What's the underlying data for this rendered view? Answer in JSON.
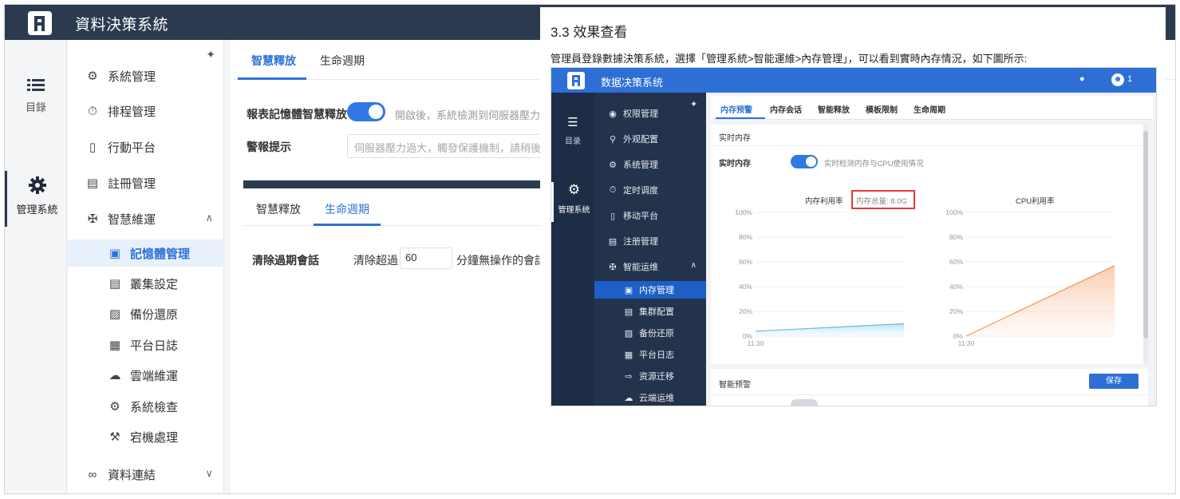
{
  "app": {
    "title": "資料決策系統",
    "iconbar": {
      "catalog_label": "目錄",
      "admin_label": "管理系統"
    },
    "menu": {
      "items": [
        {
          "label": "系統管理",
          "icon": "gear-icon"
        },
        {
          "label": "排程管理",
          "icon": "timer-icon"
        },
        {
          "label": "行動平台",
          "icon": "mobile-icon"
        },
        {
          "label": "註冊管理",
          "icon": "register-icon"
        },
        {
          "label": "智慧維運",
          "icon": "ops-icon"
        }
      ],
      "sub_items": [
        {
          "label": "記憶體管理",
          "icon": "memory-icon"
        },
        {
          "label": "叢集設定",
          "icon": "cluster-icon"
        },
        {
          "label": "備份還原",
          "icon": "backup-icon"
        },
        {
          "label": "平台日誌",
          "icon": "log-icon"
        },
        {
          "label": "雲端維運",
          "icon": "cloud-icon"
        },
        {
          "label": "系統檢查",
          "icon": "check-icon"
        },
        {
          "label": "宕機處理",
          "icon": "wrench-icon"
        }
      ],
      "data_link": {
        "label": "資料連結",
        "icon": "link-icon"
      }
    },
    "tabs": [
      "智慧釋放",
      "生命週期"
    ],
    "release": {
      "toggle_label": "報表記憶體智慧釋放",
      "toggle_hint": "開啟後，系統檢測到伺服器壓力過",
      "toggle_on": true,
      "alert_label": "警報提示",
      "alert_placeholder": "伺服器壓力過大，觸發保護機制，請稍後"
    },
    "tabs2": [
      "智慧釋放",
      "生命週期"
    ],
    "lifecycle": {
      "label": "清除過期會話",
      "prefix": "清除超過",
      "value": "60",
      "suffix": "分鐘無操作的會話"
    }
  },
  "doc": {
    "heading": "3.3 效果查看",
    "paragraph": "管理員登錄數據決策系統，選擇「管理系統>智能運維>內存管理」，可以看到實時內存情況，如下圖所示:",
    "screenshot": {
      "title": "数据决策系统",
      "user": "1",
      "catalog_label": "目录",
      "admin_label": "管理系统",
      "menu": [
        "权限管理",
        "外观配置",
        "系统管理",
        "定时调度",
        "移动平台",
        "注册管理",
        "智能运维"
      ],
      "sub_menu": [
        "内存管理",
        "集群配置",
        "备份还原",
        "平台日志",
        "资源迁移",
        "云端运维"
      ],
      "tabs": [
        "内存预警",
        "内存会话",
        "智能释放",
        "模板限制",
        "生命周期"
      ],
      "section_title": "实时内存",
      "toggle_label": "实时内存",
      "toggle_hint": "实时检测内存与CPU使用情况",
      "memory_chart_title": "内存利用率",
      "memory_total": "内存总量: 8.0G",
      "cpu_chart_title": "CPU利用率",
      "section2_title": "智能预警",
      "save_button": "保存"
    },
    "colors": {
      "accent": "#2e6fd6",
      "dark_nav": "#24334c",
      "red_box": "#e53935"
    }
  },
  "chart_data": [
    {
      "type": "area",
      "title": "内存利用率",
      "x": [
        "11:30",
        ""
      ],
      "y_ticks": [
        "100%",
        "80%",
        "60%",
        "40%",
        "20%",
        "0%"
      ],
      "ylim": [
        0,
        100
      ],
      "series": [
        {
          "values": [
            4,
            10
          ]
        }
      ]
    },
    {
      "type": "area",
      "title": "CPU利用率",
      "x": [
        "11:30",
        ""
      ],
      "y_ticks": [
        "100%",
        "80%",
        "60%",
        "40%",
        "20%",
        "0%"
      ],
      "ylim": [
        0,
        100
      ],
      "series": [
        {
          "values": [
            0,
            57
          ]
        }
      ]
    }
  ]
}
